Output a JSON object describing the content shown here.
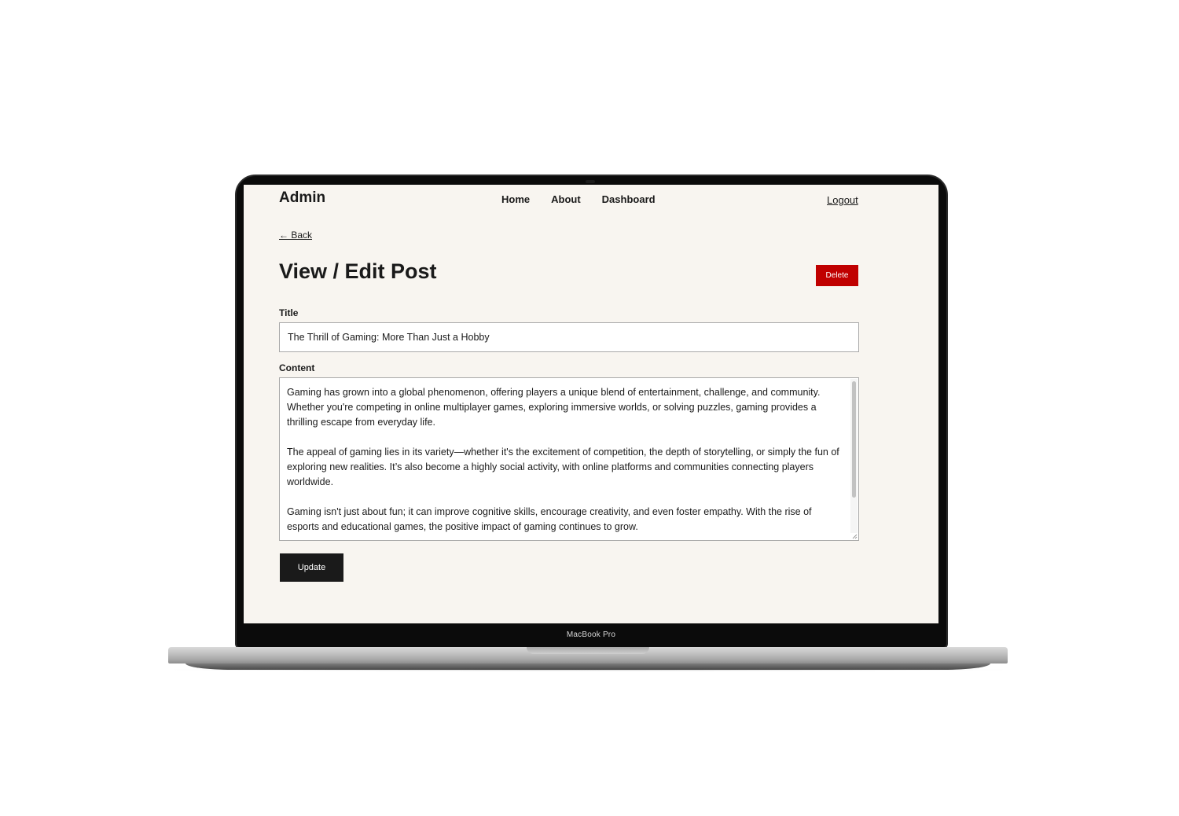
{
  "device": {
    "bezel_label": "MacBook Pro"
  },
  "header": {
    "brand": "Admin",
    "nav": [
      {
        "label": "Home"
      },
      {
        "label": "About"
      },
      {
        "label": "Dashboard"
      }
    ],
    "logout_label": "Logout"
  },
  "page": {
    "back_label": "← Back",
    "title": "View / Edit Post",
    "delete_label": "Delete"
  },
  "form": {
    "title_label": "Title",
    "title_value": "The Thrill of Gaming: More Than Just a Hobby",
    "content_label": "Content",
    "content_paragraphs": [
      "Gaming has grown into a global phenomenon, offering players a unique blend of entertainment, challenge, and community. Whether you're competing in online multiplayer games, exploring immersive worlds, or solving puzzles, gaming provides a thrilling escape from everyday life.",
      "The appeal of gaming lies in its variety—whether it's the excitement of competition, the depth of storytelling, or simply the fun of exploring new realities. It’s also become a highly social activity, with online platforms and communities connecting players worldwide.",
      "Gaming isn't just about fun; it can improve cognitive skills, encourage creativity, and even foster empathy. With the rise of esports and educational games, the positive impact of gaming continues to grow."
    ],
    "update_label": "Update"
  },
  "colors": {
    "screen_background": "#f8f5f0",
    "delete_button": "#c00000",
    "update_button": "#1a1a1a",
    "text": "#1a1a1a"
  }
}
